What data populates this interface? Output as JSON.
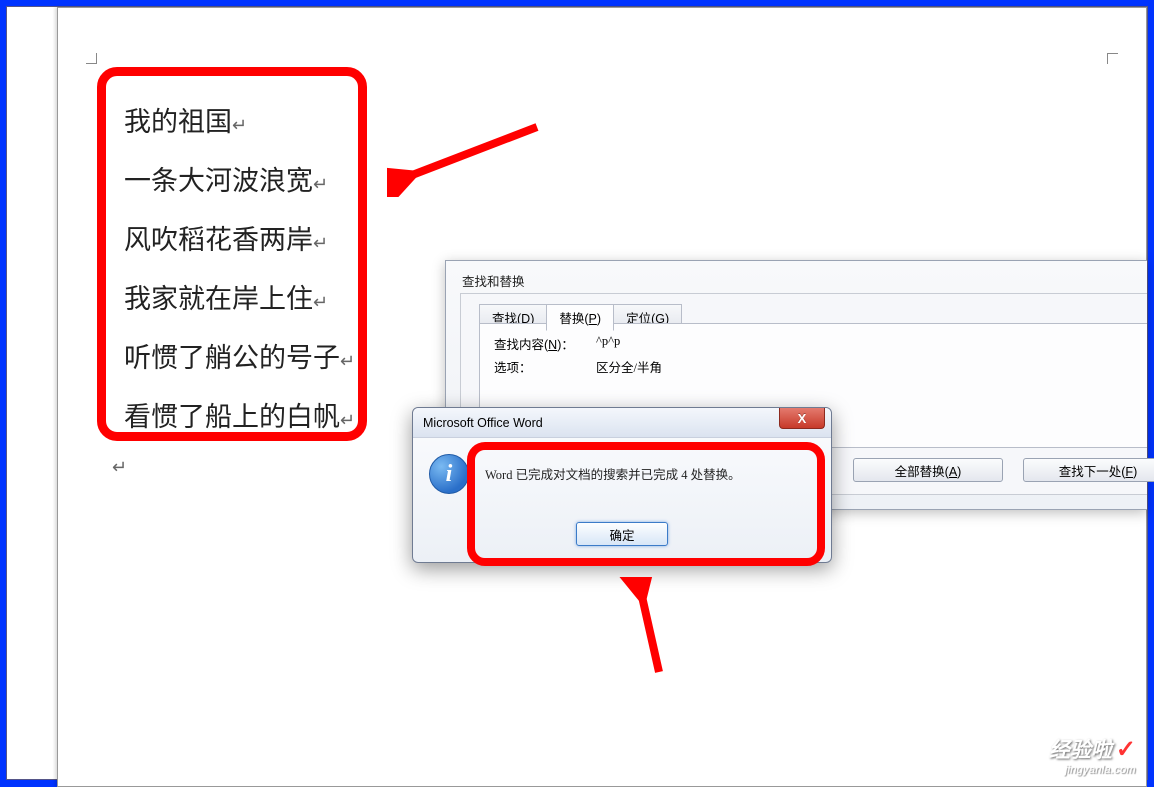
{
  "poem": {
    "lines": [
      "我的祖国",
      "一条大河波浪宽",
      "风吹稻花香两岸",
      "我家就在岸上住",
      "听惯了艄公的号子",
      "看惯了船上的白帆"
    ],
    "para_mark": "↵"
  },
  "find_replace": {
    "title": "查找和替换",
    "tabs": {
      "find": "查找(D)",
      "replace": "替换(P)",
      "goto": "定位(G)"
    },
    "labels": {
      "find_what": "查找内容(N)：",
      "options": "选项："
    },
    "values": {
      "find_what": "^p^p",
      "options": "区分全/半角"
    },
    "buttons": {
      "replace_all": "全部替换(A)",
      "find_next": "查找下一处(F)"
    }
  },
  "msg": {
    "title": "Microsoft Office Word",
    "text": "Word 已完成对文档的搜索并已完成 4 处替换。",
    "ok": "确定",
    "close": "X",
    "info_glyph": "i"
  },
  "watermark": {
    "cn": "经验啦",
    "check": "✓",
    "en": "jingyanla.com"
  }
}
